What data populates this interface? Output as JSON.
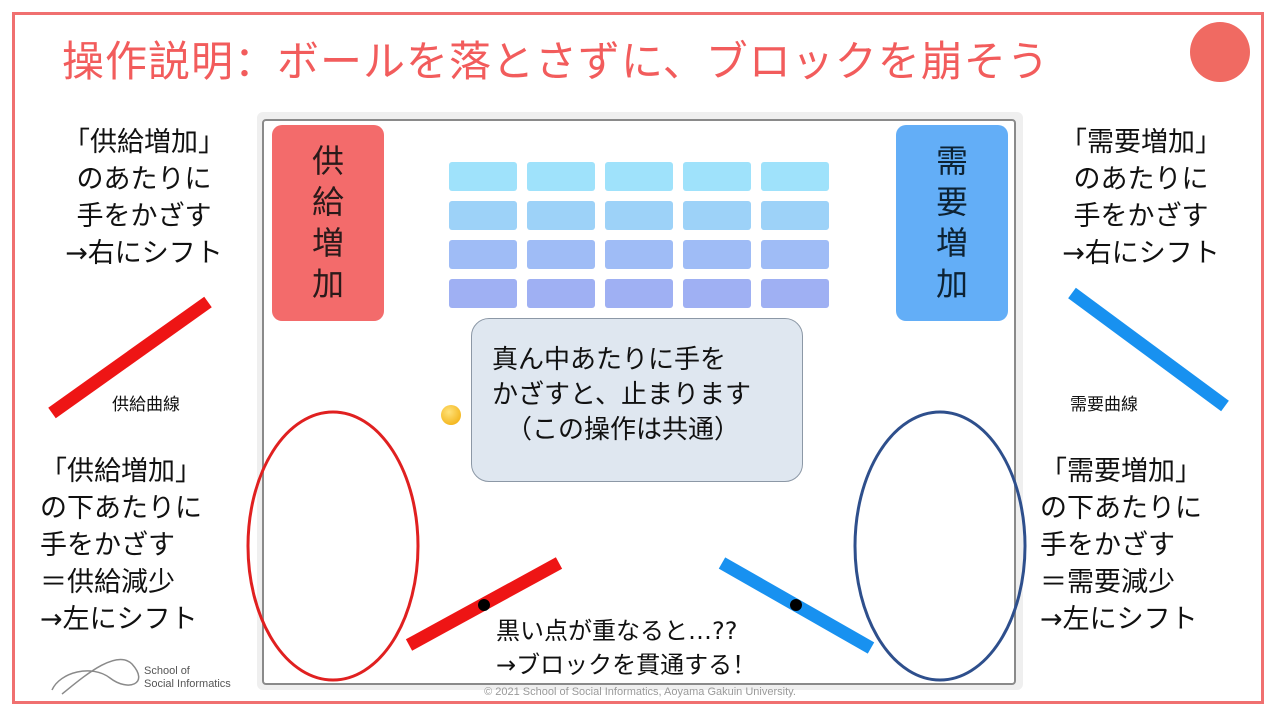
{
  "title": "操作説明：ボールを落とさずに、ブロックを崩そう",
  "supply_box": {
    "label": [
      "供",
      "給",
      "増",
      "加"
    ],
    "color": "#f36b6b"
  },
  "demand_box": {
    "label": [
      "需",
      "要",
      "増",
      "加"
    ],
    "color": "#63aef7"
  },
  "left_top_text": [
    "「供給増加」",
    "のあたりに",
    "手をかざす",
    "→右にシフト"
  ],
  "left_bottom_text": [
    "「供給増加」",
    "の下あたりに",
    "手をかざす",
    "＝供給減少",
    "→左にシフト"
  ],
  "right_top_text": [
    "「需要増加」",
    "のあたりに",
    "手をかざす",
    "→右にシフト"
  ],
  "right_bottom_text": [
    "「需要増加」",
    "の下あたりに",
    "手をかざす",
    "＝需要減少",
    "→左にシフト"
  ],
  "supply_curve_label": "供給曲線",
  "demand_curve_label": "需要曲線",
  "center_bubble": [
    "真ん中あたりに手を",
    "かざすと、止まります",
    "（この操作は共通）"
  ],
  "bottom_text": [
    "黒い点が重なると…??",
    "→ブロックを貫通する！"
  ],
  "brick_rows": [
    {
      "color": "#9fe2fb",
      "count": 5
    },
    {
      "color": "#9dd2f8",
      "count": 5
    },
    {
      "color": "#9fbcf6",
      "count": 5
    },
    {
      "color": "#9fb0f3",
      "count": 5
    }
  ],
  "colors": {
    "title": "#f25c5c",
    "frame": "#f07070",
    "supply_line": "#ee1515",
    "demand_line": "#1891f0",
    "supply_ellipse": "#e02020",
    "demand_ellipse": "#2e4f8c"
  },
  "logo": {
    "line1": "School of",
    "line2": "Social Informatics"
  },
  "copyright": "© 2021 School of Social Informatics, Aoyama Gakuin University."
}
